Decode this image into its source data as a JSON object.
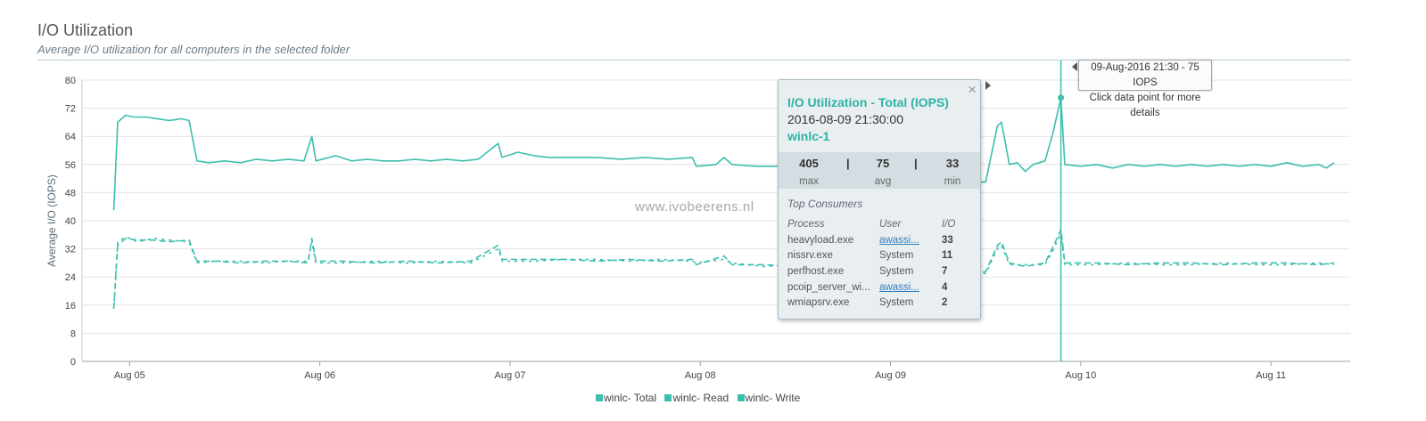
{
  "header": {
    "title": "I/O Utilization",
    "subtitle": "Average I/O utilization for all computers in the selected folder"
  },
  "watermark": "www.ivobeerens.nl",
  "colors": {
    "series": "#3cbfae",
    "accent": "#2fb3a6",
    "grid": "#e3e3e3"
  },
  "chart_data": {
    "type": "line",
    "ylabel": "Average I/O (IOPS)",
    "ylim": [
      0,
      80
    ],
    "yticks": [
      0,
      8,
      16,
      24,
      32,
      40,
      48,
      56,
      64,
      72,
      80
    ],
    "xlim": [
      "2016-08-04T18:00",
      "2016-08-11T10:00"
    ],
    "xticks": [
      {
        "label": "Aug 05",
        "t": "2016-08-05T00:00"
      },
      {
        "label": "Aug 06",
        "t": "2016-08-06T00:00"
      },
      {
        "label": "Aug 07",
        "t": "2016-08-07T00:00"
      },
      {
        "label": "Aug 08",
        "t": "2016-08-08T00:00"
      },
      {
        "label": "Aug 09",
        "t": "2016-08-09T00:00"
      },
      {
        "label": "Aug 10",
        "t": "2016-08-10T00:00"
      },
      {
        "label": "Aug 11",
        "t": "2016-08-11T00:00"
      }
    ],
    "legend": [
      "winlc- Total",
      "winlc- Read",
      "winlc- Write"
    ],
    "legend_position": "bottom-center",
    "series": [
      {
        "name": "winlc- Total",
        "style": "solid",
        "points": [
          [
            "2016-08-04T22:00",
            43
          ],
          [
            "2016-08-04T22:30",
            68
          ],
          [
            "2016-08-04T23:30",
            70
          ],
          [
            "2016-08-05T00:30",
            69.5
          ],
          [
            "2016-08-05T02:00",
            69.5
          ],
          [
            "2016-08-05T03:30",
            69
          ],
          [
            "2016-08-05T05:00",
            68.5
          ],
          [
            "2016-08-05T06:30",
            69
          ],
          [
            "2016-08-05T07:30",
            68.5
          ],
          [
            "2016-08-05T08:30",
            57
          ],
          [
            "2016-08-05T10:00",
            56.5
          ],
          [
            "2016-08-05T12:00",
            57
          ],
          [
            "2016-08-05T14:00",
            56.5
          ],
          [
            "2016-08-05T16:00",
            57.5
          ],
          [
            "2016-08-05T18:00",
            57
          ],
          [
            "2016-08-05T20:00",
            57.5
          ],
          [
            "2016-08-05T22:00",
            57
          ],
          [
            "2016-08-05T23:00",
            64
          ],
          [
            "2016-08-05T23:30",
            57
          ],
          [
            "2016-08-06T02:00",
            58.5
          ],
          [
            "2016-08-06T04:00",
            57
          ],
          [
            "2016-08-06T06:00",
            57.5
          ],
          [
            "2016-08-06T08:00",
            57
          ],
          [
            "2016-08-06T10:00",
            57
          ],
          [
            "2016-08-06T12:00",
            57.5
          ],
          [
            "2016-08-06T14:00",
            57
          ],
          [
            "2016-08-06T16:00",
            57.5
          ],
          [
            "2016-08-06T18:00",
            57
          ],
          [
            "2016-08-06T20:00",
            57.5
          ],
          [
            "2016-08-06T22:30",
            62
          ],
          [
            "2016-08-06T23:00",
            58
          ],
          [
            "2016-08-07T01:00",
            59.5
          ],
          [
            "2016-08-07T03:00",
            58.5
          ],
          [
            "2016-08-07T05:00",
            58
          ],
          [
            "2016-08-07T08:00",
            58
          ],
          [
            "2016-08-07T11:00",
            58
          ],
          [
            "2016-08-07T14:00",
            57.5
          ],
          [
            "2016-08-07T17:00",
            58
          ],
          [
            "2016-08-07T20:00",
            57.5
          ],
          [
            "2016-08-07T23:00",
            58
          ],
          [
            "2016-08-07T23:30",
            55.5
          ],
          [
            "2016-08-08T02:00",
            56
          ],
          [
            "2016-08-08T03:00",
            58
          ],
          [
            "2016-08-08T04:00",
            56
          ],
          [
            "2016-08-08T07:00",
            55.5
          ],
          [
            "2016-08-08T10:00",
            55.5
          ],
          [
            "2016-08-08T13:00",
            55
          ],
          [
            "2016-08-08T16:00",
            54
          ],
          [
            "2016-08-08T19:00",
            53.5
          ],
          [
            "2016-08-08T22:00",
            53
          ],
          [
            "2016-08-09T01:00",
            52.5
          ],
          [
            "2016-08-09T04:00",
            51.5
          ],
          [
            "2016-08-09T07:00",
            50.5
          ],
          [
            "2016-08-09T10:00",
            50
          ],
          [
            "2016-08-09T11:00",
            51
          ],
          [
            "2016-08-09T12:00",
            51
          ],
          [
            "2016-08-09T13:30",
            67
          ],
          [
            "2016-08-09T14:00",
            68
          ],
          [
            "2016-08-09T15:00",
            56
          ],
          [
            "2016-08-09T16:00",
            56.5
          ],
          [
            "2016-08-09T17:00",
            54
          ],
          [
            "2016-08-09T18:00",
            56
          ],
          [
            "2016-08-09T19:30",
            57
          ],
          [
            "2016-08-09T20:30",
            65
          ],
          [
            "2016-08-09T21:30",
            75
          ],
          [
            "2016-08-09T22:00",
            56
          ],
          [
            "2016-08-10T00:00",
            55.5
          ],
          [
            "2016-08-10T02:00",
            56
          ],
          [
            "2016-08-10T04:00",
            55
          ],
          [
            "2016-08-10T06:00",
            56
          ],
          [
            "2016-08-10T08:00",
            55.5
          ],
          [
            "2016-08-10T10:00",
            56
          ],
          [
            "2016-08-10T12:00",
            55.5
          ],
          [
            "2016-08-10T14:00",
            56
          ],
          [
            "2016-08-10T16:00",
            55.5
          ],
          [
            "2016-08-10T18:00",
            56
          ],
          [
            "2016-08-10T20:00",
            55.5
          ],
          [
            "2016-08-10T22:00",
            56
          ],
          [
            "2016-08-11T00:00",
            55.5
          ],
          [
            "2016-08-11T02:00",
            56.5
          ],
          [
            "2016-08-11T04:00",
            55.5
          ],
          [
            "2016-08-11T06:00",
            56
          ],
          [
            "2016-08-11T07:00",
            55
          ],
          [
            "2016-08-11T08:00",
            56.5
          ]
        ]
      },
      {
        "name": "winlc- Read",
        "style": "dashed",
        "points": [
          [
            "2016-08-04T22:00",
            15
          ],
          [
            "2016-08-04T22:30",
            33
          ],
          [
            "2016-08-04T23:30",
            35
          ],
          [
            "2016-08-05T01:00",
            34.5
          ],
          [
            "2016-08-05T03:00",
            34.5
          ],
          [
            "2016-08-05T05:00",
            34
          ],
          [
            "2016-08-05T07:30",
            34.5
          ],
          [
            "2016-08-05T08:30",
            28.5
          ],
          [
            "2016-08-05T11:00",
            28.5
          ],
          [
            "2016-08-05T14:00",
            28
          ],
          [
            "2016-08-05T17:00",
            28.5
          ],
          [
            "2016-08-05T20:00",
            28.5
          ],
          [
            "2016-08-05T22:30",
            28
          ],
          [
            "2016-08-05T23:00",
            35
          ],
          [
            "2016-08-05T23:30",
            28.5
          ],
          [
            "2016-08-06T03:00",
            28.5
          ],
          [
            "2016-08-06T07:00",
            28
          ],
          [
            "2016-08-06T11:00",
            28.5
          ],
          [
            "2016-08-06T15:00",
            28
          ],
          [
            "2016-08-06T19:00",
            28.5
          ],
          [
            "2016-08-06T22:30",
            33
          ],
          [
            "2016-08-06T23:00",
            29
          ],
          [
            "2016-08-07T03:00",
            29
          ],
          [
            "2016-08-07T07:00",
            29
          ],
          [
            "2016-08-07T11:00",
            28.5
          ],
          [
            "2016-08-07T15:00",
            29
          ],
          [
            "2016-08-07T19:00",
            28.5
          ],
          [
            "2016-08-07T23:00",
            29
          ],
          [
            "2016-08-07T23:30",
            27.5
          ],
          [
            "2016-08-08T03:00",
            30
          ],
          [
            "2016-08-08T04:00",
            27.5
          ],
          [
            "2016-08-08T08:00",
            27.5
          ],
          [
            "2016-08-08T12:00",
            27
          ],
          [
            "2016-08-08T16:00",
            26.5
          ],
          [
            "2016-08-08T20:00",
            26
          ],
          [
            "2016-08-09T00:00",
            26
          ],
          [
            "2016-08-09T04:00",
            25.5
          ],
          [
            "2016-08-09T08:00",
            25
          ],
          [
            "2016-08-09T12:00",
            25.5
          ],
          [
            "2016-08-09T13:30",
            33
          ],
          [
            "2016-08-09T14:00",
            34
          ],
          [
            "2016-08-09T15:00",
            28
          ],
          [
            "2016-08-09T17:00",
            27
          ],
          [
            "2016-08-09T19:30",
            28
          ],
          [
            "2016-08-09T20:30",
            32.5
          ],
          [
            "2016-08-09T21:30",
            37.5
          ],
          [
            "2016-08-09T22:00",
            28
          ],
          [
            "2016-08-10T02:00",
            28
          ],
          [
            "2016-08-10T06:00",
            27.5
          ],
          [
            "2016-08-10T10:00",
            28
          ],
          [
            "2016-08-10T14:00",
            28
          ],
          [
            "2016-08-10T18:00",
            27.5
          ],
          [
            "2016-08-10T22:00",
            28
          ],
          [
            "2016-08-11T02:00",
            28
          ],
          [
            "2016-08-11T06:00",
            27.5
          ],
          [
            "2016-08-11T08:00",
            28
          ]
        ]
      },
      {
        "name": "winlc- Write",
        "style": "dashed",
        "points": [
          [
            "2016-08-04T22:00",
            15
          ],
          [
            "2016-08-04T22:30",
            34
          ],
          [
            "2016-08-04T23:30",
            35.5
          ],
          [
            "2016-08-05T01:00",
            34
          ],
          [
            "2016-08-05T03:00",
            35
          ],
          [
            "2016-08-05T05:00",
            34.5
          ],
          [
            "2016-08-05T07:30",
            34
          ],
          [
            "2016-08-05T08:30",
            28
          ],
          [
            "2016-08-05T11:00",
            28.5
          ],
          [
            "2016-08-05T14:00",
            28.5
          ],
          [
            "2016-08-05T17:00",
            28
          ],
          [
            "2016-08-05T20:00",
            28.5
          ],
          [
            "2016-08-05T22:30",
            28.5
          ],
          [
            "2016-08-05T23:00",
            34
          ],
          [
            "2016-08-05T23:30",
            28
          ],
          [
            "2016-08-06T03:00",
            28
          ],
          [
            "2016-08-06T07:00",
            28.5
          ],
          [
            "2016-08-06T11:00",
            28
          ],
          [
            "2016-08-06T15:00",
            28.5
          ],
          [
            "2016-08-06T19:00",
            28
          ],
          [
            "2016-08-06T22:30",
            32
          ],
          [
            "2016-08-06T23:00",
            28.5
          ],
          [
            "2016-08-07T03:00",
            28.5
          ],
          [
            "2016-08-07T07:00",
            29
          ],
          [
            "2016-08-07T11:00",
            29
          ],
          [
            "2016-08-07T15:00",
            28.5
          ],
          [
            "2016-08-07T19:00",
            29
          ],
          [
            "2016-08-07T23:00",
            28.5
          ],
          [
            "2016-08-07T23:30",
            28
          ],
          [
            "2016-08-08T03:00",
            29
          ],
          [
            "2016-08-08T04:00",
            28
          ],
          [
            "2016-08-08T08:00",
            27
          ],
          [
            "2016-08-08T12:00",
            27.5
          ],
          [
            "2016-08-08T16:00",
            27
          ],
          [
            "2016-08-08T20:00",
            26.5
          ],
          [
            "2016-08-09T00:00",
            25.5
          ],
          [
            "2016-08-09T04:00",
            26
          ],
          [
            "2016-08-09T08:00",
            25.5
          ],
          [
            "2016-08-09T12:00",
            25
          ],
          [
            "2016-08-09T13:30",
            32
          ],
          [
            "2016-08-09T14:00",
            33
          ],
          [
            "2016-08-09T15:00",
            27.5
          ],
          [
            "2016-08-09T17:00",
            27.5
          ],
          [
            "2016-08-09T19:30",
            27.5
          ],
          [
            "2016-08-09T20:30",
            31.5
          ],
          [
            "2016-08-09T21:30",
            36.5
          ],
          [
            "2016-08-09T22:00",
            27.5
          ],
          [
            "2016-08-10T02:00",
            27.5
          ],
          [
            "2016-08-10T06:00",
            28
          ],
          [
            "2016-08-10T10:00",
            27.5
          ],
          [
            "2016-08-10T14:00",
            27.5
          ],
          [
            "2016-08-10T18:00",
            28
          ],
          [
            "2016-08-10T22:00",
            27.5
          ],
          [
            "2016-08-11T02:00",
            27.5
          ],
          [
            "2016-08-11T06:00",
            28
          ],
          [
            "2016-08-11T08:00",
            27.5
          ]
        ]
      }
    ],
    "crosshair": {
      "t": "2016-08-09T21:30",
      "value": 75
    }
  },
  "hover_tooltip": {
    "line1": "09-Aug-2016 21:30 - 75 IOPS",
    "line2": "Click data point for more details"
  },
  "detail_panel": {
    "close_glyph": "×",
    "title": "I/O Utilization - Total (IOPS)",
    "datetime": "2016-08-09 21:30:00",
    "host": "winlc-1",
    "stats": {
      "max": "405",
      "avg": "75",
      "min": "33",
      "max_label": "max",
      "avg_label": "avg",
      "min_label": "min",
      "separator": "|"
    },
    "top_consumers_label": "Top Consumers",
    "columns": {
      "process": "Process",
      "user": "User",
      "io": "I/O"
    },
    "rows": [
      {
        "process": "heavyload.exe",
        "user": "awassi...",
        "user_link": true,
        "io": "33"
      },
      {
        "process": "nissrv.exe",
        "user": "System",
        "user_link": false,
        "io": "11"
      },
      {
        "process": "perfhost.exe",
        "user": "System",
        "user_link": false,
        "io": "7"
      },
      {
        "process": "pcoip_server_wi...",
        "user": "awassi...",
        "user_link": true,
        "io": "4"
      },
      {
        "process": "wmiapsrv.exe",
        "user": "System",
        "user_link": false,
        "io": "2"
      }
    ]
  }
}
